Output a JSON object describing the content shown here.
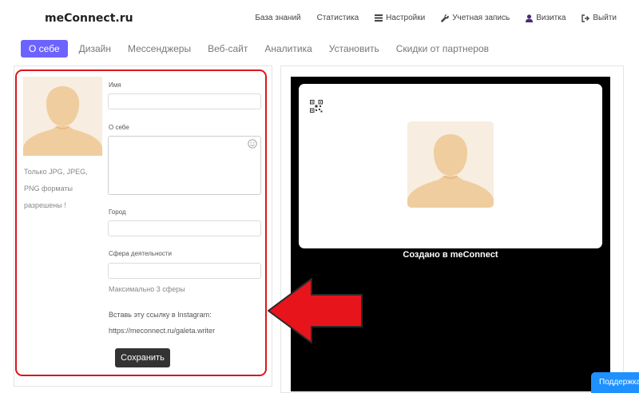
{
  "app": {
    "logo": "meConnect.ru"
  },
  "topnav": {
    "items": [
      {
        "label": "База знаний",
        "icon": ""
      },
      {
        "label": "Статистика",
        "icon": ""
      },
      {
        "label": "Настройки",
        "icon": "menu-icon"
      },
      {
        "label": "Учетная запись",
        "icon": "wrench-icon"
      },
      {
        "label": "Визитка",
        "icon": "user-icon"
      },
      {
        "label": "Выйти",
        "icon": "sign-out-icon"
      }
    ]
  },
  "tabs": {
    "items": [
      {
        "label": "О себе",
        "active": true
      },
      {
        "label": "Дизайн",
        "active": false
      },
      {
        "label": "Мессенджеры",
        "active": false
      },
      {
        "label": "Веб-сайт",
        "active": false
      },
      {
        "label": "Аналитика",
        "active": false
      },
      {
        "label": "Установить",
        "active": false
      },
      {
        "label": "Скидки от партнеров",
        "active": false
      }
    ]
  },
  "form": {
    "avatar_hint": "Только JPG, JPEG, PNG форматы разрешены !",
    "name_label": "Имя",
    "name_value": "",
    "about_label": "О себе",
    "about_value": "",
    "city_label": "Город",
    "city_value": "",
    "sphere_label": "Сфера деятельности",
    "sphere_value": "",
    "sphere_hint": "Максимально 3 сферы",
    "instagram_label": "Вставь эту ссылку в Instagram:",
    "instagram_link": "https://meconnect.ru/galeta.writer",
    "save_label": "Сохранить"
  },
  "preview": {
    "created_text": "Создано в meConnect"
  },
  "support": {
    "label": "Поддержка"
  },
  "colors": {
    "accent": "#6c63ff",
    "highlight_frame": "#d9161c",
    "arrow": "#e8141b",
    "support_button": "#1e90ff",
    "avatar_bg": "#f7ede0",
    "avatar_figure": "#f0cd9e"
  }
}
